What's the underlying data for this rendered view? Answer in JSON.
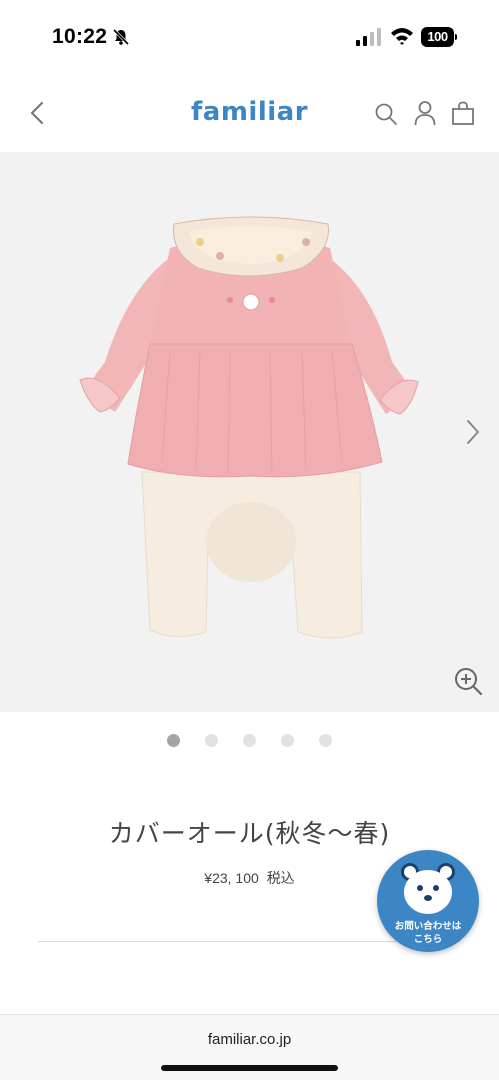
{
  "status_bar": {
    "time": "10:22",
    "battery": "100",
    "icons": [
      "bell-slash-icon",
      "signal-icon",
      "wifi-icon",
      "battery-icon"
    ]
  },
  "header": {
    "logo": "familiar",
    "icons": [
      "back-icon",
      "search-icon",
      "account-icon",
      "bag-icon"
    ],
    "brand_color": "#3d86c6"
  },
  "gallery": {
    "image": "pink-baby-coverall-photo",
    "slide_count": 5,
    "active_slide": 1,
    "background": "#f2f2f2"
  },
  "product": {
    "title": "カバーオール(秋冬〜春)",
    "price": "¥23, 100",
    "tax_label": "税込"
  },
  "contact_badge": {
    "line1": "お問い合わせは",
    "line2": "こちら",
    "color": "#3d86c6"
  },
  "browser": {
    "url": "familiar.co.jp"
  }
}
